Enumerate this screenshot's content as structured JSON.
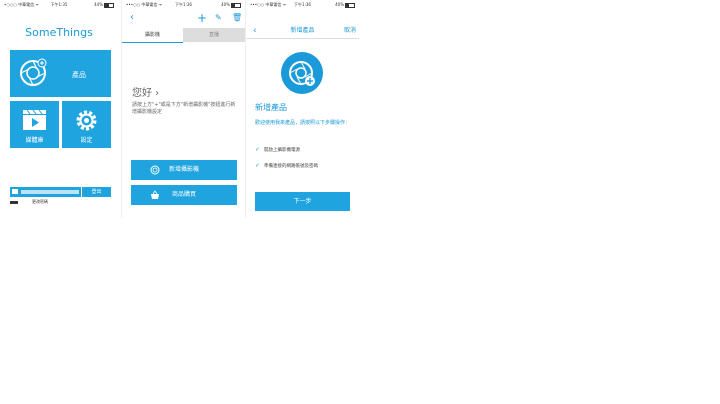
{
  "panels": {
    "home": {
      "status": {
        "carrier": "•○○○ 中華電信 ᯤ",
        "time": "下午1:35",
        "battery": "44%"
      },
      "brand": "SomeThings",
      "tiles": {
        "products": "產品",
        "media": "媒體庫",
        "settings": "設定"
      },
      "logout": "登出",
      "change_password": "更改密碼"
    },
    "camera": {
      "status": {
        "carrier": "•••○○ 中華電信 ᯤ",
        "time": "下午1:36",
        "battery": "40%"
      },
      "nav": {
        "back": "‹",
        "add": "+",
        "edit": "✎",
        "delete": "🗑"
      },
      "tabs": {
        "camera": "攝影機",
        "live": "直播"
      },
      "greeting": "您好 ›",
      "hint": "請按上方\"+\"或是下方\"新增攝影機\"按鈕進行新增攝影機設定",
      "add_camera": "新增攝影機",
      "buy": "商品購買"
    },
    "new_product": {
      "status": {
        "carrier": "•••○○ 中華電信 ᯤ",
        "time": "下午1:36",
        "battery": "40%"
      },
      "header": {
        "back": "‹",
        "title": "新增產品",
        "cancel": "取消"
      },
      "title": "新增產品",
      "description": "歡迎使用我來產品，請按照以下步驟操作：",
      "steps": [
        "開啟上攝影機電源",
        "準備連接的網路帳號及密碼"
      ],
      "next": "下一步"
    }
  },
  "colors": {
    "accent": "#1fa4e0",
    "accent_dark": "#1a9ad8",
    "tab_inactive": "#dddddd"
  },
  "battery_levels": {
    "home": 44,
    "camera": 40,
    "new_product": 40
  }
}
